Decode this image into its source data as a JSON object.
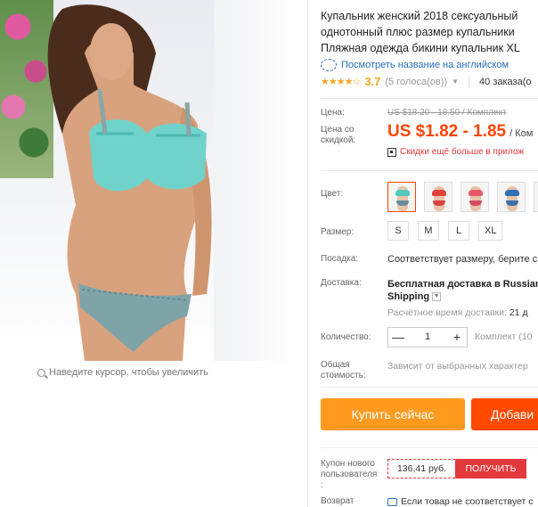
{
  "gallery": {
    "zoom_hint": "Наведите курсор, чтобы увеличить"
  },
  "product": {
    "title_line1": "Купальник женский 2018 сексуальный",
    "title_line2": "однотонный плюс размер купальники",
    "title_line3": "Пляжная одежда бикини купальник XL",
    "translate_link": "Посмотреть название на английском",
    "stars": "★★★★☆",
    "rating": "3.7",
    "votes": "(5 голоса(ов))",
    "orders": "40 заказа(о"
  },
  "price": {
    "label": "Цена:",
    "old": "US $18.20 - 18.50 / Комплект",
    "discount_label_line1": "Цена со",
    "discount_label_line2": "скидкой:",
    "sale": "US $1.82 - 1.85",
    "sale_unit": "/ Ком",
    "app_promo": "Скидки ещё больше в прилож"
  },
  "options": {
    "color_label": "Цвет:",
    "colors": [
      {
        "name": "teal",
        "top": "#4fc9c0",
        "bottom": "#6a8f9a"
      },
      {
        "name": "red",
        "top": "#e0413d",
        "bottom": "#d94340"
      },
      {
        "name": "pink",
        "top": "#e6576a",
        "bottom": "#d64c5f"
      },
      {
        "name": "blue",
        "top": "#2f6fb5",
        "bottom": "#3d6ea8"
      },
      {
        "name": "navy",
        "top": "#4d8fd1",
        "bottom": "#2c5a96"
      }
    ],
    "size_label": "Размер:",
    "sizes": [
      "S",
      "M",
      "L",
      "XL"
    ],
    "fit_label": "Посадка:",
    "fit_value": "Соответствует размеру, берите с",
    "shipping_label": "Доставка:",
    "shipping_line1": "Бесплатная доставка в Russian",
    "shipping_line2": "Shipping",
    "eta_label": "Расчётное время доставки:",
    "eta_value": "21 д",
    "qty_label": "Количество:",
    "qty_minus": "—",
    "qty_value": "1",
    "qty_plus": "+",
    "stock": "Комплект (10",
    "total_label_line1": "Общая",
    "total_label_line2": "стоимость:",
    "total_value": "Зависит от выбранных характер"
  },
  "actions": {
    "buy": "Купить сейчас",
    "cart": "Добави"
  },
  "coupon": {
    "label_line1": "Купон нового",
    "label_line2": "пользователя",
    "label_line3": ":",
    "amount": "136,41 руб.",
    "get": "ПОЛУЧИТЬ"
  },
  "returns": {
    "label": "Возврат",
    "text": "Если товар не соответствует с"
  },
  "colors": {
    "accent": "#ff4400",
    "buy": "#ff9a1e",
    "cart": "#ff4a00",
    "link": "#2a6ebb"
  }
}
